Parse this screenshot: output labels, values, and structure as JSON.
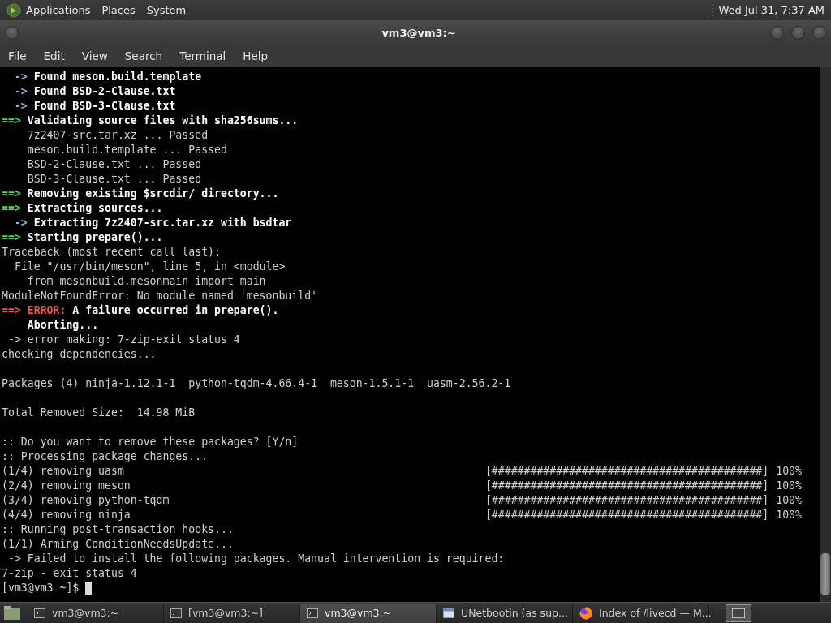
{
  "top_panel": {
    "menus": [
      "Applications",
      "Places",
      "System"
    ],
    "clock": "Wed Jul 31, 7:37 AM"
  },
  "window": {
    "title": "vm3@vm3:~"
  },
  "menu_bar": [
    "File",
    "Edit",
    "View",
    "Search",
    "Terminal",
    "Help"
  ],
  "terminal": {
    "lines": [
      {
        "kind": "text",
        "segments": [
          {
            "kind": "arrow",
            "text": "  -> "
          },
          {
            "kind": "bold",
            "text": "Found meson.build.template"
          }
        ]
      },
      {
        "kind": "text",
        "segments": [
          {
            "kind": "arrow",
            "text": "  -> "
          },
          {
            "kind": "bold",
            "text": "Found BSD-2-Clause.txt"
          }
        ]
      },
      {
        "kind": "text",
        "segments": [
          {
            "kind": "arrow",
            "text": "  -> "
          },
          {
            "kind": "bold",
            "text": "Found BSD-3-Clause.txt"
          }
        ]
      },
      {
        "kind": "text",
        "segments": [
          {
            "kind": "step",
            "text": "==> "
          },
          {
            "kind": "bold",
            "text": "Validating source files with sha256sums..."
          }
        ]
      },
      {
        "kind": "text",
        "segments": [
          {
            "kind": "plain",
            "text": "    7z2407-src.tar.xz ... Passed"
          }
        ]
      },
      {
        "kind": "text",
        "segments": [
          {
            "kind": "plain",
            "text": "    meson.build.template ... Passed"
          }
        ]
      },
      {
        "kind": "text",
        "segments": [
          {
            "kind": "plain",
            "text": "    BSD-2-Clause.txt ... Passed"
          }
        ]
      },
      {
        "kind": "text",
        "segments": [
          {
            "kind": "plain",
            "text": "    BSD-3-Clause.txt ... Passed"
          }
        ]
      },
      {
        "kind": "text",
        "segments": [
          {
            "kind": "step",
            "text": "==> "
          },
          {
            "kind": "bold",
            "text": "Removing existing $srcdir/ directory..."
          }
        ]
      },
      {
        "kind": "text",
        "segments": [
          {
            "kind": "step",
            "text": "==> "
          },
          {
            "kind": "bold",
            "text": "Extracting sources..."
          }
        ]
      },
      {
        "kind": "text",
        "segments": [
          {
            "kind": "arrow",
            "text": "  -> "
          },
          {
            "kind": "bold",
            "text": "Extracting 7z2407-src.tar.xz with bsdtar"
          }
        ]
      },
      {
        "kind": "text",
        "segments": [
          {
            "kind": "step",
            "text": "==> "
          },
          {
            "kind": "bold",
            "text": "Starting prepare()..."
          }
        ]
      },
      {
        "kind": "text",
        "segments": [
          {
            "kind": "plain",
            "text": "Traceback (most recent call last):"
          }
        ]
      },
      {
        "kind": "text",
        "segments": [
          {
            "kind": "plain",
            "text": "  File \"/usr/bin/meson\", line 5, in <module>"
          }
        ]
      },
      {
        "kind": "text",
        "segments": [
          {
            "kind": "plain",
            "text": "    from mesonbuild.mesonmain import main"
          }
        ]
      },
      {
        "kind": "text",
        "segments": [
          {
            "kind": "plain",
            "text": "ModuleNotFoundError: No module named 'mesonbuild'"
          }
        ]
      },
      {
        "kind": "text",
        "segments": [
          {
            "kind": "error",
            "text": "==> ERROR: "
          },
          {
            "kind": "bold",
            "text": "A failure occurred in prepare()."
          }
        ]
      },
      {
        "kind": "text",
        "segments": [
          {
            "kind": "bold",
            "text": "    Aborting..."
          }
        ]
      },
      {
        "kind": "text",
        "segments": [
          {
            "kind": "plain",
            "text": " -> error making: 7-zip-exit status 4"
          }
        ]
      },
      {
        "kind": "text",
        "segments": [
          {
            "kind": "plain",
            "text": "checking dependencies..."
          }
        ]
      },
      {
        "kind": "blank"
      },
      {
        "kind": "text",
        "segments": [
          {
            "kind": "plain",
            "text": "Packages (4) ninja-1.12.1-1  python-tqdm-4.66.4-1  meson-1.5.1-1  uasm-2.56.2-1"
          }
        ]
      },
      {
        "kind": "blank"
      },
      {
        "kind": "text",
        "segments": [
          {
            "kind": "plain",
            "text": "Total Removed Size:  14.98 MiB"
          }
        ]
      },
      {
        "kind": "blank"
      },
      {
        "kind": "text",
        "segments": [
          {
            "kind": "plain",
            "text": ":: Do you want to remove these packages? [Y/n]"
          }
        ]
      },
      {
        "kind": "text",
        "segments": [
          {
            "kind": "plain",
            "text": ":: Processing package changes..."
          }
        ]
      },
      {
        "kind": "progress",
        "label": "(1/4) removing uasm",
        "bar": "[##########################################]",
        "percent": "100%"
      },
      {
        "kind": "progress",
        "label": "(2/4) removing meson",
        "bar": "[##########################################]",
        "percent": "100%"
      },
      {
        "kind": "progress",
        "label": "(3/4) removing python-tqdm",
        "bar": "[##########################################]",
        "percent": "100%"
      },
      {
        "kind": "progress",
        "label": "(4/4) removing ninja",
        "bar": "[##########################################]",
        "percent": "100%"
      },
      {
        "kind": "text",
        "segments": [
          {
            "kind": "plain",
            "text": ":: Running post-transaction hooks..."
          }
        ]
      },
      {
        "kind": "text",
        "segments": [
          {
            "kind": "plain",
            "text": "(1/1) Arming ConditionNeedsUpdate..."
          }
        ]
      },
      {
        "kind": "text",
        "segments": [
          {
            "kind": "plain",
            "text": " -> Failed to install the following packages. Manual intervention is required:"
          }
        ]
      },
      {
        "kind": "text",
        "segments": [
          {
            "kind": "plain",
            "text": "7-zip - exit status 4"
          }
        ]
      },
      {
        "kind": "prompt",
        "text": "[vm3@vm3 ~]$ "
      }
    ]
  },
  "taskbar": {
    "tasks": [
      {
        "label": "vm3@vm3:~",
        "kind": "terminal",
        "selected": false
      },
      {
        "label": "[vm3@vm3:~]",
        "kind": "terminal",
        "selected": false
      },
      {
        "label": "vm3@vm3:~",
        "kind": "terminal",
        "selected": true
      },
      {
        "label": "UNetbootin (as sup...",
        "kind": "window",
        "selected": false
      },
      {
        "label": "Index of /livecd — M...",
        "kind": "browser",
        "selected": false
      }
    ]
  }
}
